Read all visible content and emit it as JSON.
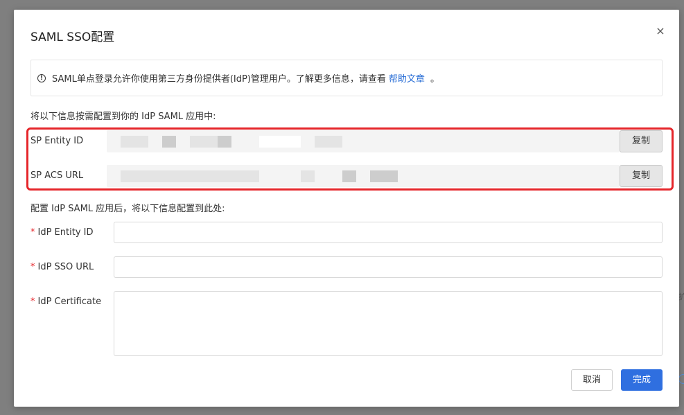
{
  "modal": {
    "title": "SAML SSO配置",
    "close_glyph": "×"
  },
  "info": {
    "icon_glyph": "!",
    "text": "SAML单点登录允许你使用第三方身份提供者(IdP)管理用户。了解更多信息，请查看",
    "link_label": "帮助文章",
    "suffix": "。"
  },
  "sp_section": {
    "heading": "将以下信息按需配置到你的 IdP SAML 应用中:",
    "entity_id_label": "SP Entity ID",
    "acs_url_label": "SP ACS URL",
    "copy_label": "复制",
    "highlight_color": "#e5252a"
  },
  "idp_section": {
    "heading": "配置 IdP SAML 应用后，将以下信息配置到此处:",
    "required_mark": "*",
    "entity_id_label": "IdP Entity ID",
    "sso_url_label": "IdP SSO URL",
    "certificate_label": "IdP Certificate",
    "entity_id_value": "",
    "sso_url_value": "",
    "certificate_value": ""
  },
  "footer": {
    "cancel_label": "取消",
    "done_label": "完成",
    "primary_color": "#2f6fe0"
  }
}
